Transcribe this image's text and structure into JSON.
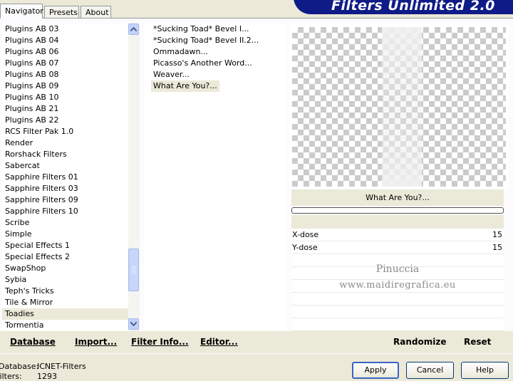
{
  "header": {
    "title": "Filters Unlimited 2.0"
  },
  "tabs": [
    {
      "label": "Navigator"
    },
    {
      "label": "Presets"
    },
    {
      "label": "About"
    }
  ],
  "categories": {
    "items": [
      "Plugins AB 03",
      "Plugins AB 04",
      "Plugins AB 06",
      "Plugins AB 07",
      "Plugins AB 08",
      "Plugins AB 09",
      "Plugins AB 10",
      "Plugins AB 21",
      "Plugins AB 22",
      "RCS Filter Pak 1.0",
      "Render",
      "Rorshack Filters",
      "Sabercat",
      "Sapphire Filters 01",
      "Sapphire Filters 03",
      "Sapphire Filters 09",
      "Sapphire Filters 10",
      "Scribe",
      "Simple",
      "Special Effects 1",
      "Special Effects 2",
      "SwapShop",
      "Sybia",
      "Teph's Tricks",
      "Tile & Mirror",
      "Toadies",
      "Tormentia"
    ],
    "selected": "Toadies",
    "scroll_icons": {
      "up": "arrow-up-icon",
      "down": "arrow-down-icon"
    }
  },
  "filters": {
    "items": [
      "*Sucking Toad*  Bevel I...",
      "*Sucking Toad*  Bevel II.2...",
      "Ommadawn...",
      "Picasso's Another Word...",
      "Weaver...",
      "What Are You?..."
    ],
    "selected": "What Are You?..."
  },
  "preview": {
    "filter_name": "What Are You?...",
    "params": [
      {
        "name": "X-dose",
        "value": "15"
      },
      {
        "name": "Y-dose",
        "value": "15"
      }
    ],
    "watermark": {
      "line1": "Pinuccia",
      "line2": "www.maidiregrafica.eu"
    }
  },
  "actions": {
    "database": "Database",
    "import": "Import...",
    "filter_info": "Filter Info...",
    "editor": "Editor...",
    "randomize": "Randomize",
    "reset": "Reset"
  },
  "status": {
    "database_label": "Database:",
    "database_value": "ICNET-Filters",
    "filters_label": "Filters:",
    "filters_value": "1293"
  },
  "dialog_buttons": {
    "apply": "Apply",
    "cancel": "Cancel",
    "help": "Help"
  },
  "colors": {
    "banner": "#0f1b86",
    "window_bg": "#ece9d8",
    "selection_bg": "#ebe9d8"
  }
}
